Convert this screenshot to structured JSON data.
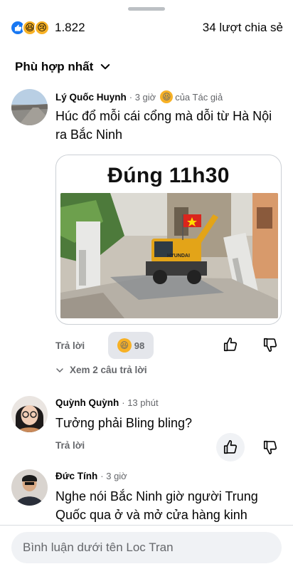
{
  "reactions": {
    "icons": [
      "like-icon",
      "haha-icon",
      "sad-icon"
    ],
    "count": "1.822",
    "shares": "34 lượt chia sẻ"
  },
  "sort": {
    "label": "Phù hợp nhất"
  },
  "comments": [
    {
      "name": "Lý Quốc Huynh",
      "time": "· 3 giờ",
      "author_badge": "của Tác giả",
      "text": "Húc đổ mỗi cái cổng mà dỗi từ Hà Nội ra Bắc Ninh",
      "media_title": "Đúng 11h30",
      "reply_label": "Trả lời",
      "reaction_count": "98",
      "view_replies": "Xem 2 câu trả lời"
    },
    {
      "name": "Quỳnh Quỳnh",
      "time": "· 13 phút",
      "text": "Tưởng phải Bling bling?",
      "reply_label": "Trả lời"
    },
    {
      "name": "Đức Tính",
      "time": "· 3 giờ",
      "text": "Nghe nói Bắc Ninh giờ người Trung Quốc qua ở và mở cửa hàng kinh"
    }
  ],
  "composer": {
    "placeholder": "Bình luận dưới tên Loc Tran"
  },
  "colors": {
    "like_blue": "#1877f2",
    "reaction_yellow": "#f7b125",
    "muted_text": "#65676b",
    "pill_bg": "#e4e6eb"
  }
}
